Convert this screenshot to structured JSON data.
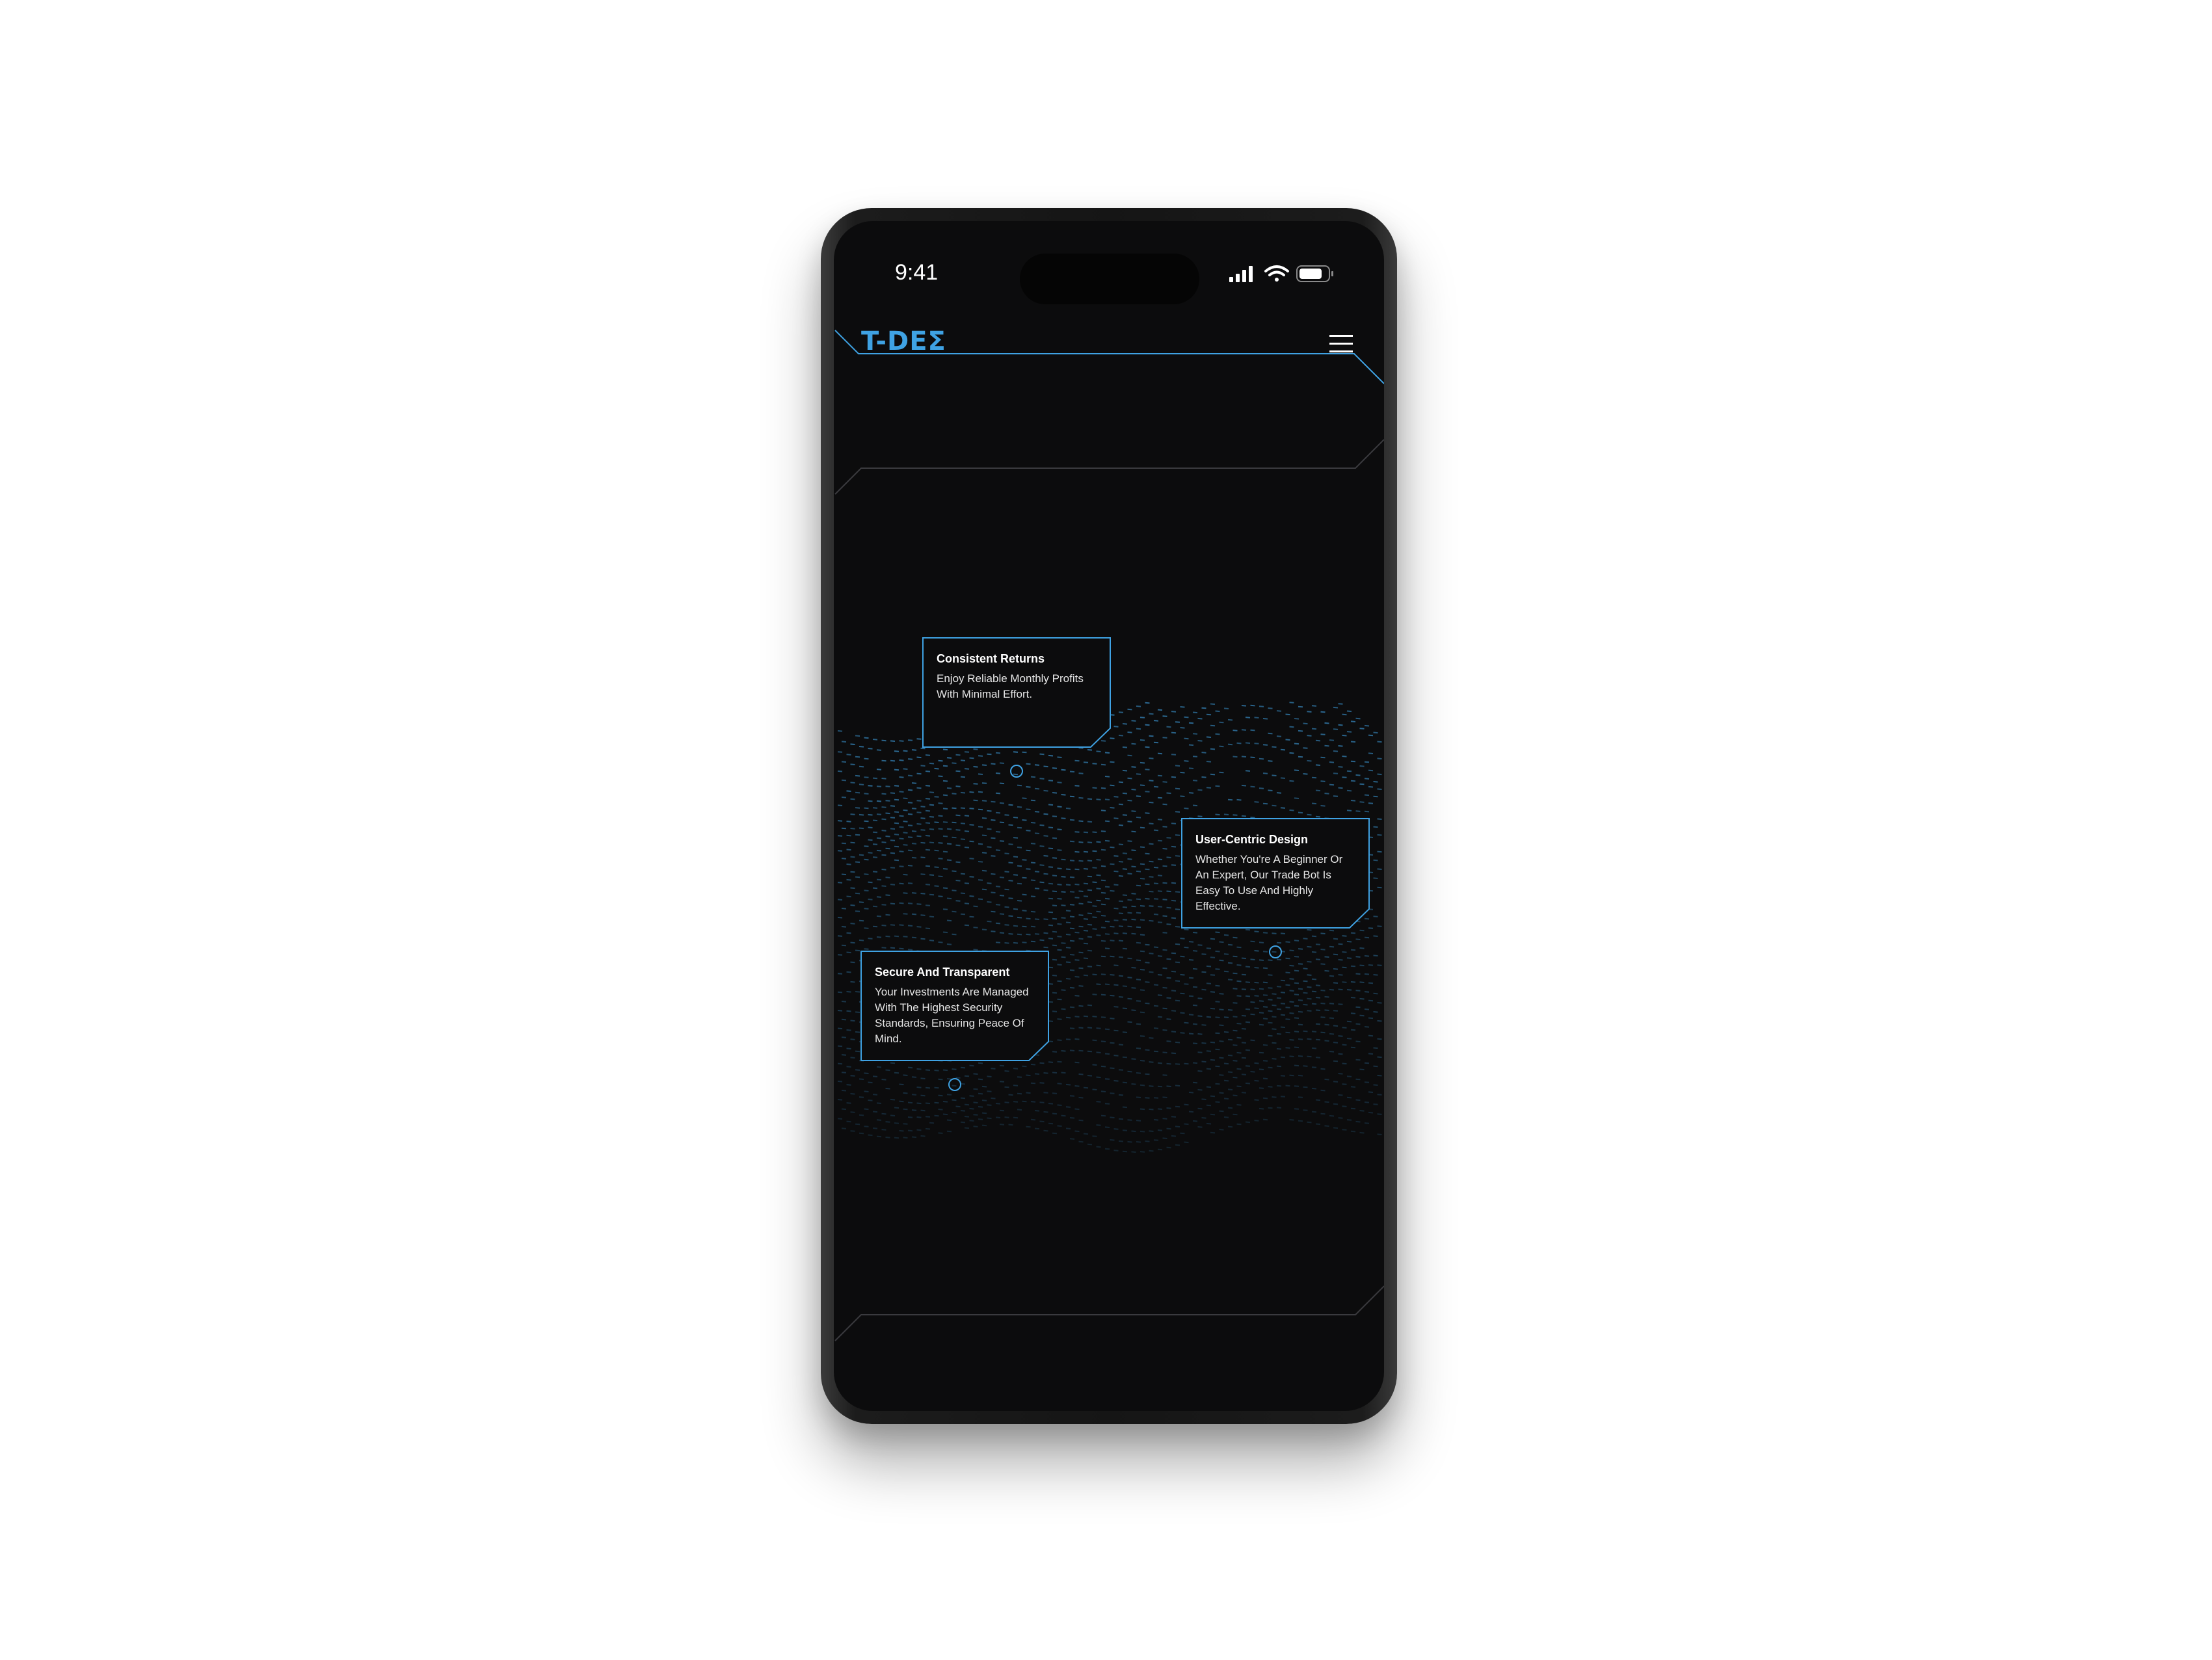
{
  "status_bar": {
    "time": "9:41"
  },
  "header": {
    "logo": "T-DEΣ",
    "menu_icon": "hamburger-menu-icon"
  },
  "features": [
    {
      "title": "Consistent Returns",
      "text": "Enjoy Reliable Monthly Profits With Minimal Effort."
    },
    {
      "title": "User-Centric Design",
      "text": "Whether You're A Beginner Or An Expert, Our Trade Bot Is Easy To Use And Highly Effective."
    },
    {
      "title": "Secure And Transparent",
      "text": "Your Investments Are Managed With The Highest Security Standards, Ensuring Peace Of Mind."
    }
  ],
  "colors": {
    "accent": "#3fa2e3",
    "background": "#0c0c0d",
    "frame_line": "#3a3a3e"
  }
}
